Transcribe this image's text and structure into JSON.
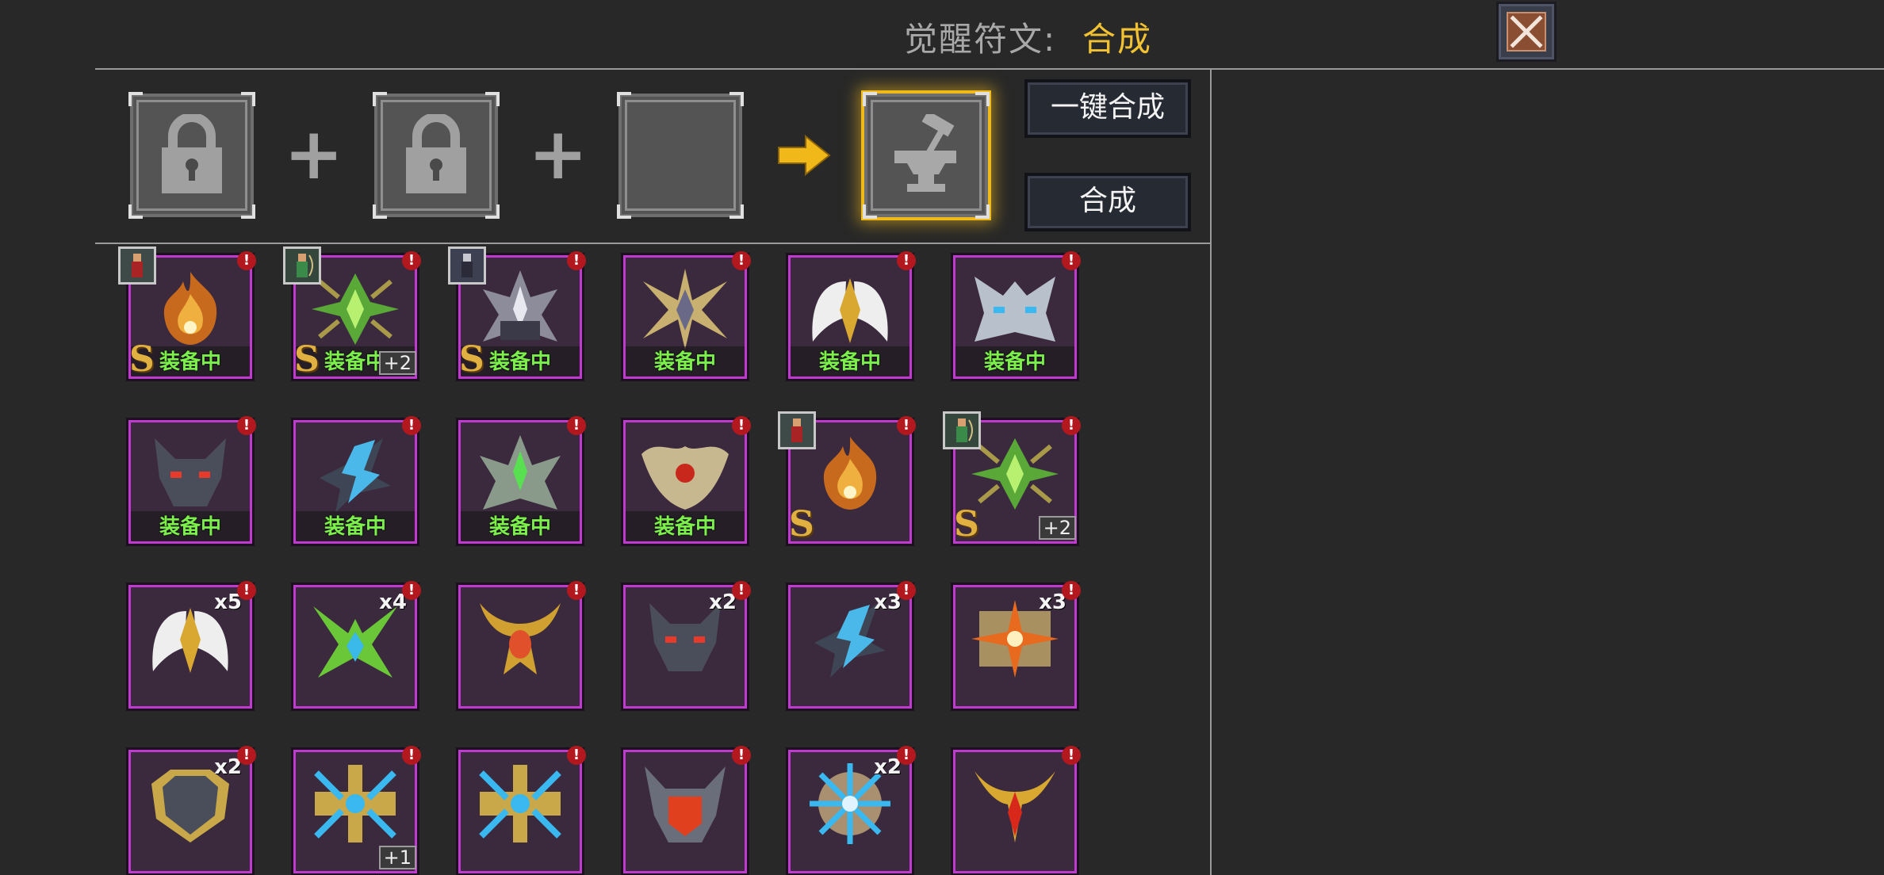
{
  "header": {
    "title_label": "觉醒符文:",
    "title_value": "合成",
    "close_icon": "close-icon"
  },
  "synthesis": {
    "slots": [
      {
        "state": "locked",
        "icon": "lock-icon"
      },
      {
        "state": "locked",
        "icon": "lock-icon"
      },
      {
        "state": "empty"
      }
    ],
    "plus_symbol": "+",
    "arrow_icon": "arrow-right-icon",
    "result_icon": "anvil-hammer-icon",
    "one_click_label": "一键合成",
    "synthesize_label": "合成"
  },
  "grid": {
    "status_equipped": "装备中",
    "rows": [
      [
        {
          "rune": "flame-rune-icon",
          "equipped": true,
          "grade": "S",
          "character": "red-warrior-avatar",
          "alert": "!"
        },
        {
          "rune": "emerald-rune-icon",
          "equipped": true,
          "grade": "S",
          "plus": "+2",
          "character": "archer-avatar",
          "alert": "!"
        },
        {
          "rune": "silver-spire-rune-icon",
          "equipped": true,
          "grade": "S",
          "character": "dark-knight-avatar",
          "alert": "!"
        },
        {
          "rune": "gold-star-rune-icon",
          "equipped": true,
          "alert": "!"
        },
        {
          "rune": "white-wings-rune-icon",
          "equipped": true,
          "alert": "!"
        },
        {
          "rune": "frost-mask-rune-icon",
          "equipped": true,
          "alert": "!"
        }
      ],
      [
        {
          "rune": "wolf-rune-icon",
          "equipped": true,
          "alert": "!"
        },
        {
          "rune": "ice-shard-rune-icon",
          "equipped": true,
          "alert": "!"
        },
        {
          "rune": "green-spire-rune-icon",
          "equipped": true,
          "alert": "!"
        },
        {
          "rune": "bone-crown-rune-icon",
          "equipped": true,
          "alert": "!"
        },
        {
          "rune": "flame-rune-icon",
          "grade": "S",
          "character": "red-warrior-avatar",
          "alert": "!"
        },
        {
          "rune": "emerald-rune-icon",
          "grade": "S",
          "plus": "+2",
          "character": "archer-avatar",
          "alert": "!"
        }
      ],
      [
        {
          "rune": "white-wings-rune-icon",
          "count": "x5",
          "alert": "!"
        },
        {
          "rune": "green-thorn-rune-icon",
          "count": "x4",
          "alert": "!"
        },
        {
          "rune": "gold-horn-rune-icon",
          "alert": "!"
        },
        {
          "rune": "wolf-rune-icon",
          "count": "x2",
          "alert": "!"
        },
        {
          "rune": "ice-shard-rune-icon",
          "count": "x3",
          "alert": "!"
        },
        {
          "rune": "sun-cross-rune-icon",
          "count": "x3",
          "alert": "!"
        }
      ],
      [
        {
          "rune": "iron-shield-rune-icon",
          "count": "x2",
          "alert": "!"
        },
        {
          "rune": "blue-cross-rune-icon",
          "plus": "+1",
          "alert": "!"
        },
        {
          "rune": "blue-cross-rune-icon",
          "alert": "!"
        },
        {
          "rune": "demon-helm-rune-icon",
          "alert": "!"
        },
        {
          "rune": "crystal-wheel-rune-icon",
          "count": "x2",
          "alert": "!"
        },
        {
          "rune": "gold-crest-rune-icon",
          "alert": "!"
        }
      ]
    ]
  },
  "colors": {
    "accent_gold": "#f2c232",
    "equipped_green": "#7cf04a",
    "cell_border": "#c13ad0",
    "alert_red": "#b2181e"
  }
}
